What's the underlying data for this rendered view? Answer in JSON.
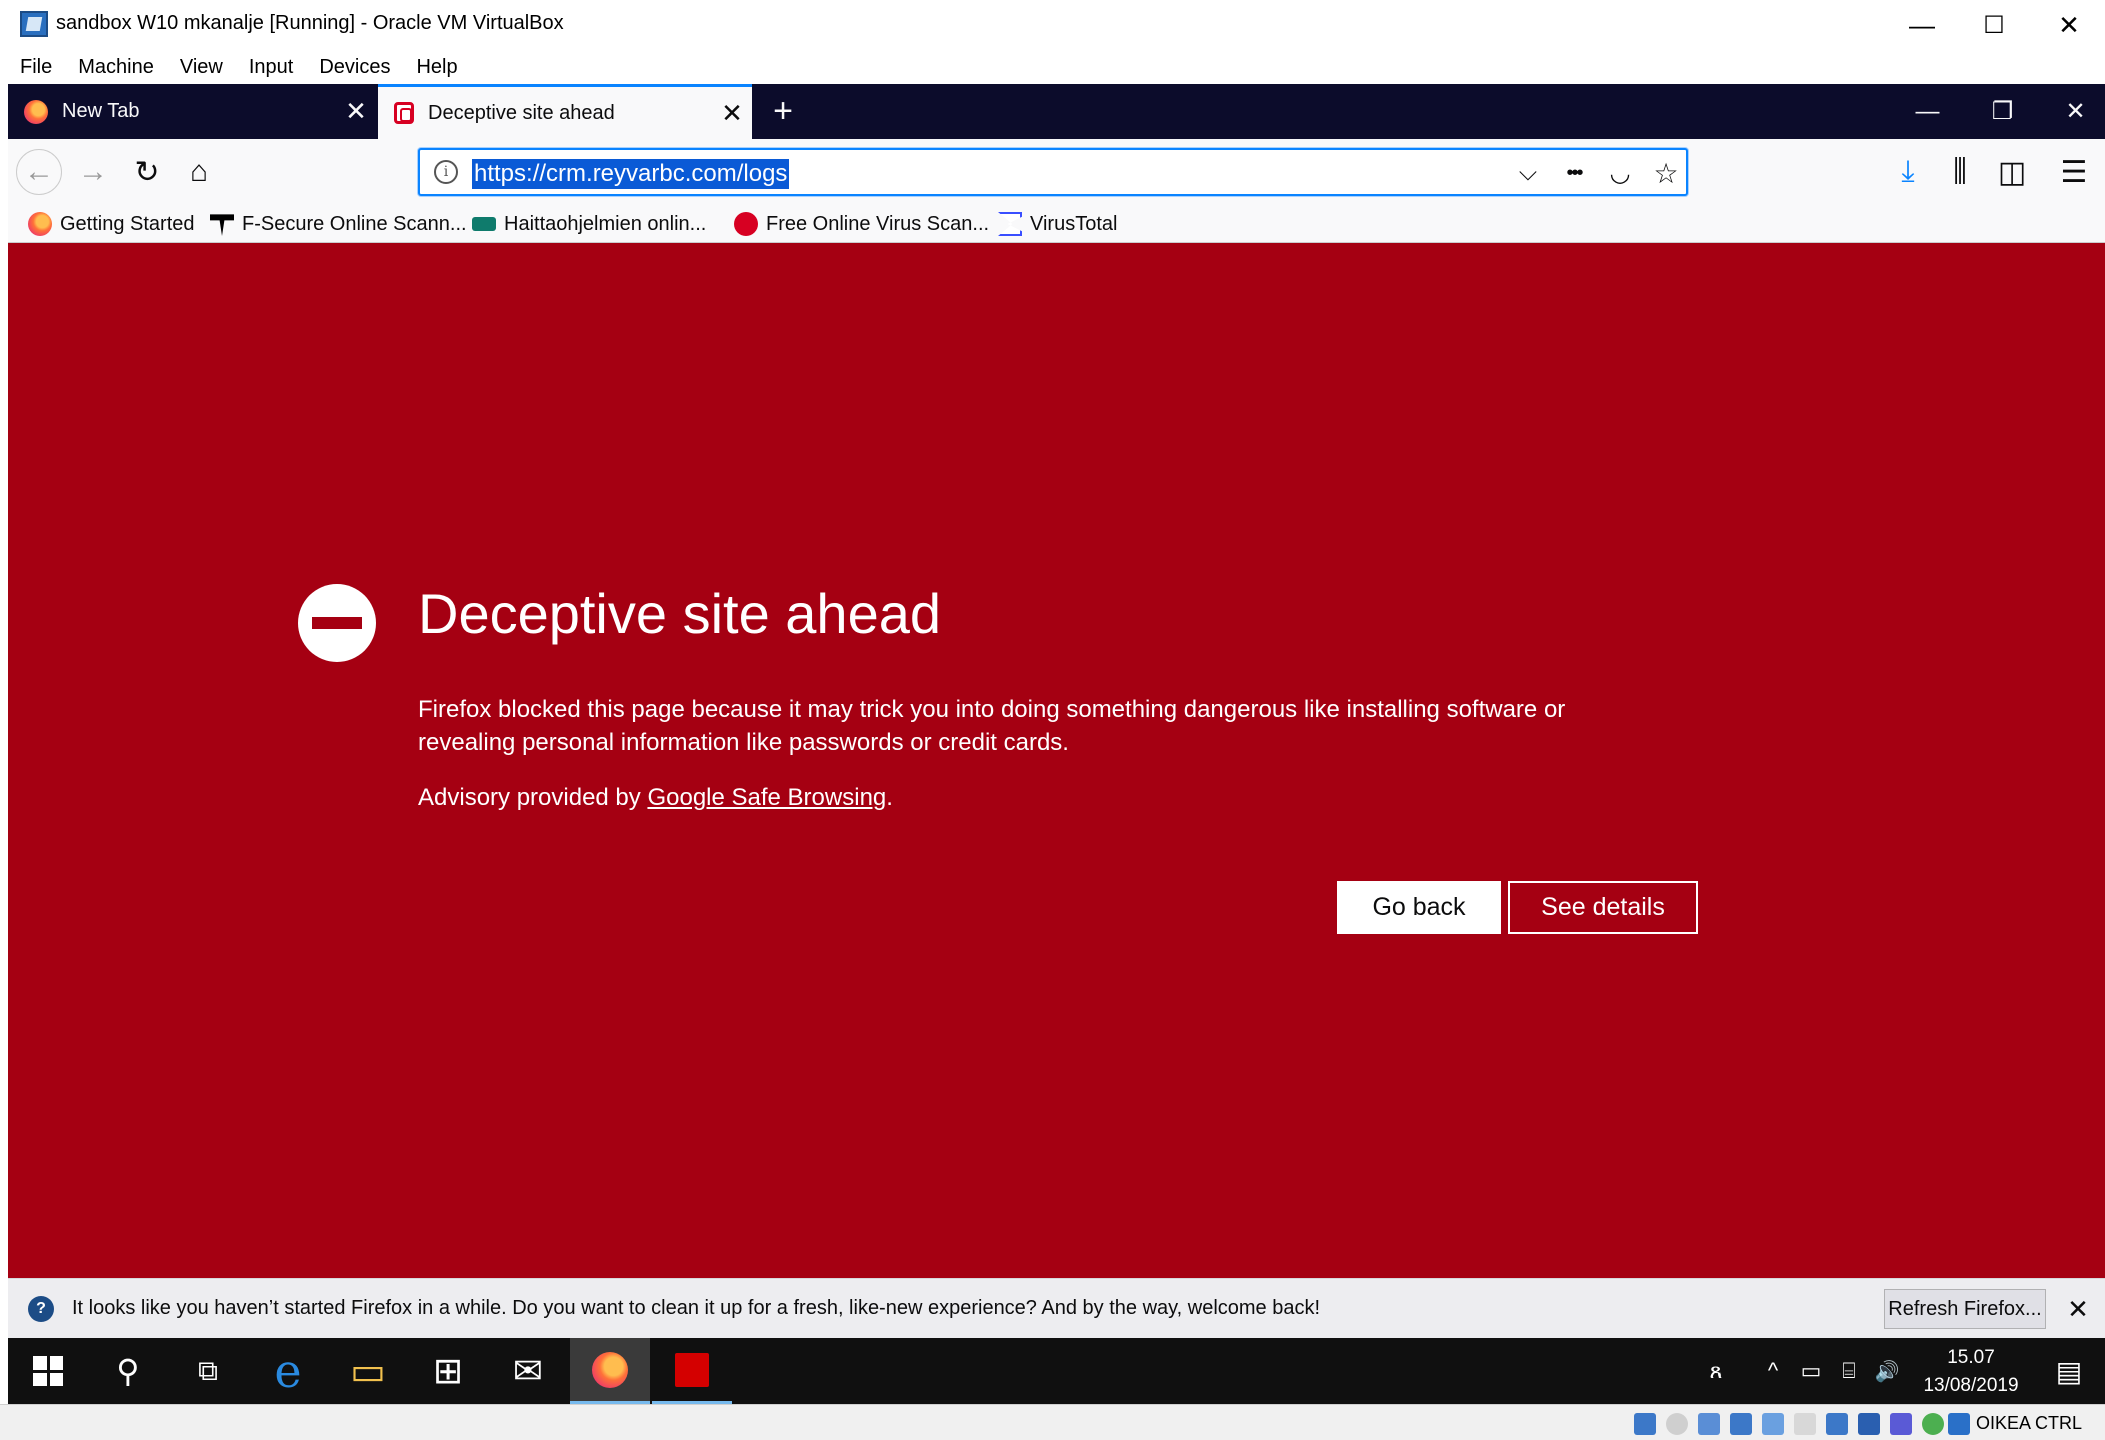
{
  "window": {
    "title": "sandbox W10 mkanalje [Running] - Oracle VM VirtualBox",
    "controls": {
      "minimize": "—",
      "maximize": "☐",
      "close": "✕"
    }
  },
  "menu": [
    "File",
    "Machine",
    "View",
    "Input",
    "Devices",
    "Help"
  ],
  "tabs": [
    {
      "label": "New Tab",
      "close": "✕",
      "icon": "firefox-icon"
    },
    {
      "label": "Deceptive site ahead",
      "close": "✕",
      "icon": "warning-page-icon"
    }
  ],
  "new_tab_symbol": "+",
  "firefox_window_controls": {
    "minimize": "—",
    "restore": "❐",
    "close": "✕"
  },
  "nav": {
    "back": "←",
    "forward": "→",
    "reload": "↻",
    "home": "⌂",
    "info": "i",
    "url": "https://crm.reyvarbc.com/logs",
    "dropdown": "⌵",
    "more": "•••",
    "pocket": "◡",
    "star": "☆",
    "download": "⤓",
    "library": "⫼",
    "sidebar": "◫",
    "menu": "☰"
  },
  "bookmarks": [
    "Getting Started",
    "F-Secure Online Scann...",
    "Haittaohjelmien onlin...",
    "Free Online Virus Scan...",
    "VirusTotal"
  ],
  "page": {
    "title": "Deceptive site ahead",
    "description": "Firefox blocked this page because it may trick you into doing something dangerous like installing software or revealing personal information like passwords or credit cards.",
    "advisory_prefix": "Advisory provided by ",
    "advisory_link": "Google Safe Browsing",
    "advisory_suffix": ".",
    "go_back": "Go back",
    "see_details": "See details"
  },
  "notification": {
    "icon": "?",
    "message": "It looks like you haven’t started Firefox in a while. Do you want to clean it up for a fresh, like-new experience? And by the way, welcome back!",
    "button": "Refresh Firefox...",
    "close": "✕"
  },
  "taskbar": {
    "search": "⚲",
    "task_view": "⧉",
    "edge": "e",
    "explorer": "▭",
    "store": "⊞",
    "mail": "✉",
    "people": "ጸ",
    "chevron": "^",
    "network": "⌸",
    "volume": "🔊",
    "clock_time": "15.07",
    "clock_date": "13/08/2019",
    "notifications": "▤"
  },
  "statusbar": {
    "host_key": "OIKEA CTRL"
  },
  "colors": {
    "page_bg": "#a50012",
    "accent": "#0a84ff",
    "tabstrip": "#0c0c2b"
  }
}
